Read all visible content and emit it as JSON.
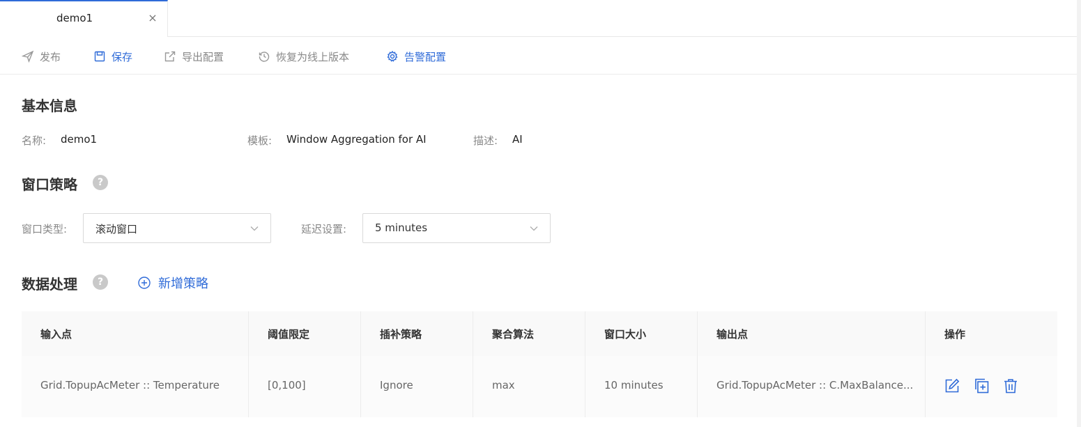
{
  "tabs": [
    {
      "label": "demo1",
      "active": true
    }
  ],
  "toolbar": {
    "publish": "发布",
    "save": "保存",
    "export": "导出配置",
    "restore": "恢复为线上版本",
    "alarm": "告警配置"
  },
  "basic_info": {
    "title": "基本信息",
    "name_label": "名称:",
    "name_value": "demo1",
    "template_label": "模板:",
    "template_value": "Window Aggregation for AI",
    "desc_label": "描述:",
    "desc_value": "AI"
  },
  "window_strategy": {
    "title": "窗口策略",
    "help": "?",
    "window_type_label": "窗口类型:",
    "window_type_value": "滚动窗口",
    "delay_label": "延迟设置:",
    "delay_value": "5 minutes"
  },
  "data_processing": {
    "title": "数据处理",
    "help": "?",
    "add_label": "新增策略",
    "columns": [
      "输入点",
      "阈值限定",
      "插补策略",
      "聚合算法",
      "窗口大小",
      "输出点",
      "操作"
    ],
    "rows": [
      {
        "input": "Grid.TopupAcMeter :: Temperature",
        "threshold": "[0,100]",
        "fill": "Ignore",
        "agg": "max",
        "window": "10 minutes",
        "output": "Grid.TopupAcMeter :: C.MaxBalance..."
      }
    ]
  },
  "colors": {
    "accent": "#2f6bd8",
    "muted": "#888888",
    "help_bg": "#c9c9c9"
  }
}
